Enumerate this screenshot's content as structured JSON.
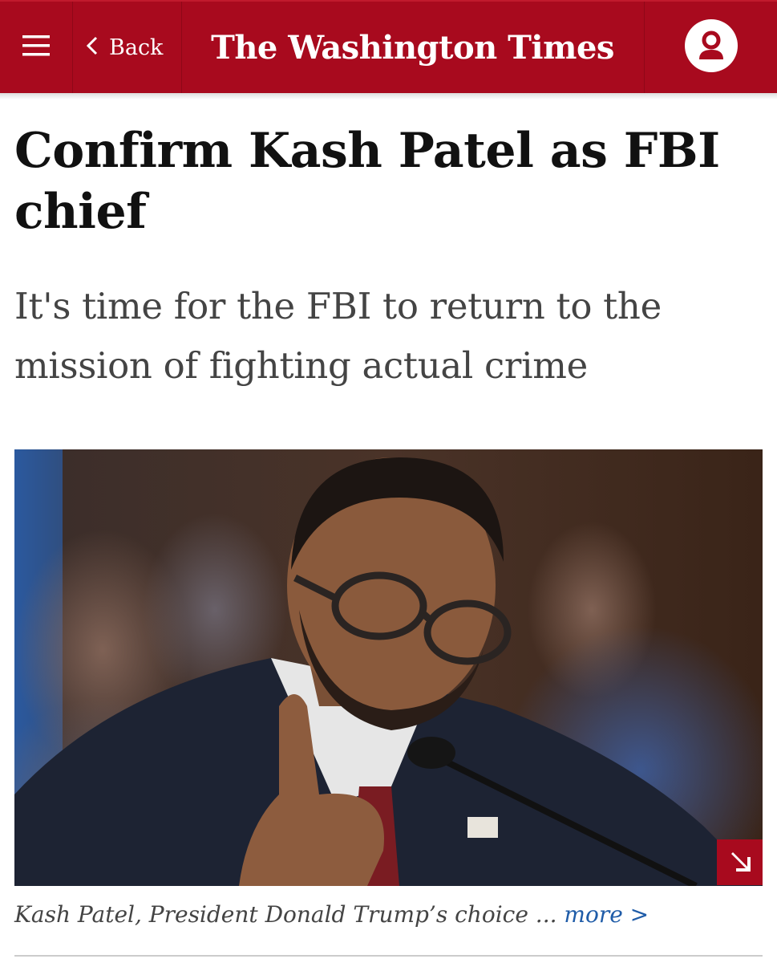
{
  "header": {
    "back_label": "Back",
    "logo_text": "The Washington Times",
    "brand_color": "#a80a1e",
    "menu_icon": "hamburger-menu-icon",
    "back_icon": "chevron-left-icon",
    "account_icon": "user-account-icon"
  },
  "article": {
    "headline": "Confirm Kash Patel as FBI chief",
    "subheadline": "It's time for the FBI to return to the mission of fighting actual crime",
    "photo": {
      "expand_icon": "expand-arrow-icon"
    },
    "caption": {
      "text": "Kash Patel, President Donald Trump’s choice ...",
      "more_label": "more >",
      "link_color": "#1f5ca8"
    }
  }
}
